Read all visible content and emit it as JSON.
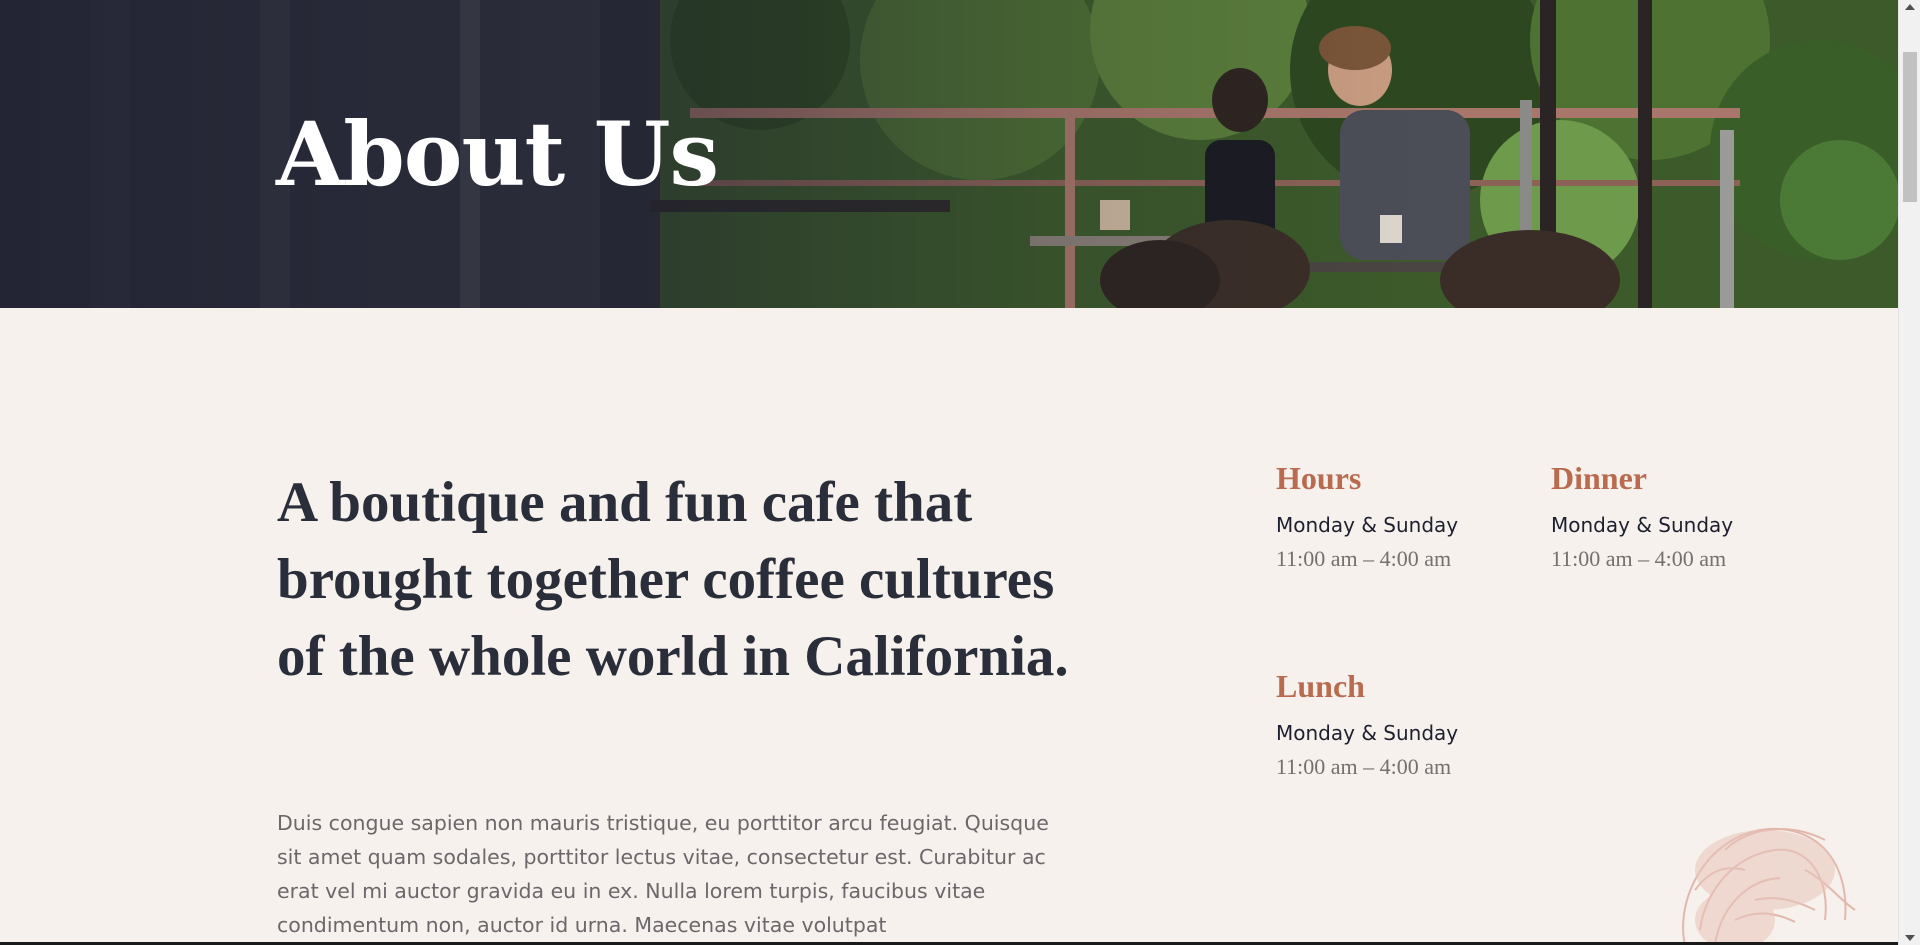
{
  "hero": {
    "title": "About Us",
    "image_alt": "couple-at-cafe-terrace-photo"
  },
  "intro": {
    "headline": "A boutique and fun cafe that brought together coffee cultures of the whole world in California.",
    "body": "Duis congue sapien non mauris tristique, eu porttitor arcu feugiat. Quisque sit amet quam sodales, porttitor lectus vitae, consectetur est. Curabitur ac erat vel mi auctor gravida eu in ex. Nulla lorem turpis, faucibus vitae condimentum non, auctor id urna. Maecenas vitae volutpat"
  },
  "schedule": {
    "hours": {
      "title": "Hours",
      "days": "Monday & Sunday",
      "time": "11:00 am – 4:00 am"
    },
    "dinner": {
      "title": "Dinner",
      "days": "Monday & Sunday",
      "time": "11:00 am – 4:00 am"
    },
    "lunch": {
      "title": "Lunch",
      "days": "Monday & Sunday",
      "time": "11:00 am – 4:00 am"
    }
  },
  "colors": {
    "background": "#f6f1ec",
    "accent": "#b86b4e",
    "headline": "#2a2d3a",
    "body": "#6c676b"
  },
  "decoration": {
    "icon": "woman-illustration-icon"
  }
}
